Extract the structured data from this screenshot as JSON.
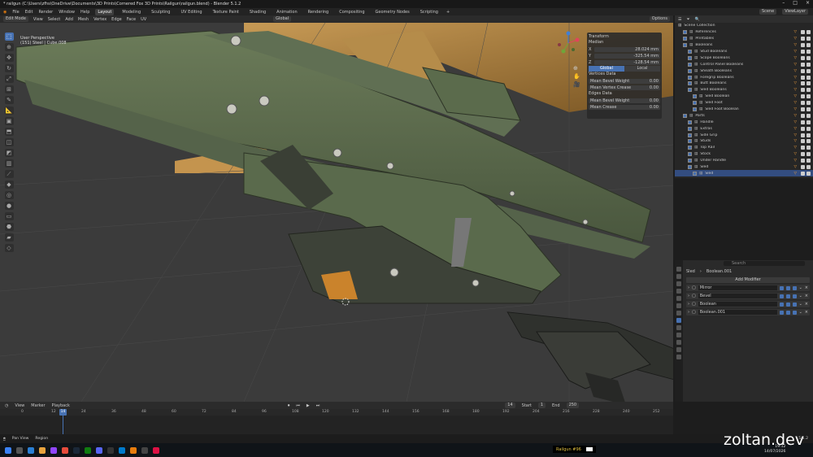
{
  "window": {
    "title": "* railgun (C:\\Users\\zfhs\\OneDrive\\Documents\\3D Prints\\Cornered Fox 3D Prints\\Railgun\\railgun.blend) - Blender 5.1.2"
  },
  "menu": {
    "items": [
      "File",
      "Edit",
      "Render",
      "Window",
      "Help"
    ],
    "workspaces": [
      "Layout",
      "Modeling",
      "Sculpting",
      "UV Editing",
      "Texture Paint",
      "Shading",
      "Animation",
      "Rendering",
      "Compositing",
      "Geometry Nodes",
      "Scripting"
    ],
    "active_workspace": "Layout",
    "scene": "Scene",
    "view_layer": "ViewLayer"
  },
  "view_header": {
    "mode": "Edit Mode",
    "items": [
      "View",
      "Select",
      "Add",
      "Mesh",
      "Vertex",
      "Edge",
      "Face",
      "UV"
    ],
    "orientation": "Global",
    "options": "Options"
  },
  "viewport": {
    "info_line1": "User Perspective",
    "info_line2": "(151) Steel | Cube.008"
  },
  "npanel": {
    "header": "Transform",
    "median": "Median",
    "x_label": "X",
    "x": "28.024 mm",
    "y_label": "Y",
    "y": "-325.54 mm",
    "z_label": "Z",
    "z": "-128.54 mm",
    "global": "Global",
    "local": "Local",
    "vertex_data": "Vertices Data",
    "mean_bevel_weight_label": "Mean Bevel Weight",
    "mean_bevel_weight": "0.00",
    "mean_vertex_crease_label": "Mean Vertex Crease",
    "mean_vertex_crease": "0.00",
    "edges_data": "Edges Data",
    "edge_bevel_label": "Mean Bevel Weight",
    "edge_bevel": "0.00",
    "edge_crease_label": "Mean Crease",
    "edge_crease": "0.00"
  },
  "outliner": {
    "title": "Scene Collection",
    "rows": [
      {
        "label": "References",
        "indent": 1,
        "sel": false
      },
      {
        "label": "Printables",
        "indent": 1,
        "sel": false
      },
      {
        "label": "Booleans",
        "indent": 1,
        "sel": false
      },
      {
        "label": "Stud Booleans",
        "indent": 2,
        "sel": false
      },
      {
        "label": "Scope Booleans",
        "indent": 2,
        "sel": false
      },
      {
        "label": "Control Panel Booleans",
        "indent": 2,
        "sel": false
      },
      {
        "label": "Sheath Booleans",
        "indent": 2,
        "sel": false
      },
      {
        "label": "Foregrip Booleans",
        "indent": 2,
        "sel": false
      },
      {
        "label": "Butt Booleans",
        "indent": 2,
        "sel": false
      },
      {
        "label": "Sled Booleans",
        "indent": 2,
        "sel": false
      },
      {
        "label": "Sled Boolean",
        "indent": 3,
        "sel": false
      },
      {
        "label": "Sled Foot",
        "indent": 3,
        "sel": false
      },
      {
        "label": "Sled Foot Boolean",
        "indent": 3,
        "sel": false
      },
      {
        "label": "Parts",
        "indent": 1,
        "sel": false
      },
      {
        "label": "Handle",
        "indent": 2,
        "sel": false
      },
      {
        "label": "Extras",
        "indent": 2,
        "sel": false
      },
      {
        "label": "Side Grip",
        "indent": 2,
        "sel": false
      },
      {
        "label": "Studs",
        "indent": 2,
        "sel": false
      },
      {
        "label": "Top Rail",
        "indent": 2,
        "sel": false
      },
      {
        "label": "Stock",
        "indent": 2,
        "sel": false
      },
      {
        "label": "Under Handle",
        "indent": 2,
        "sel": false
      },
      {
        "label": "Sled",
        "indent": 2,
        "sel": false
      },
      {
        "label": "Sled",
        "indent": 3,
        "sel": true
      }
    ]
  },
  "properties": {
    "search_placeholder": "Search",
    "breadcrumb": [
      "Sled",
      "Boolean.001"
    ],
    "add_modifier": "Add Modifier",
    "modifiers": [
      "Mirror",
      "Bevel",
      "Boolean",
      "Boolean.001"
    ]
  },
  "timeline": {
    "menu": [
      "View",
      "Marker",
      "Playback"
    ],
    "current_frame": "14",
    "start_label": "Start",
    "start": "1",
    "end_label": "End",
    "end": "250",
    "ticks": [
      "0",
      "12",
      "24",
      "36",
      "48",
      "60",
      "72",
      "84",
      "96",
      "108",
      "120",
      "132",
      "144",
      "156",
      "168",
      "180",
      "192",
      "204",
      "216",
      "228",
      "240",
      "252"
    ],
    "playhead": "14"
  },
  "status": {
    "left": "Pan View",
    "mid": "Region",
    "version": "5.1.2"
  },
  "taskbar": {
    "tag": "Railgun #96",
    "time": "19:12",
    "date": "14/07/2026"
  },
  "watermark": "zoltan.dev",
  "colors": {
    "accent": "#4772b3",
    "model_green": "#5b6b4c",
    "selected_face": "#d98b2b"
  }
}
